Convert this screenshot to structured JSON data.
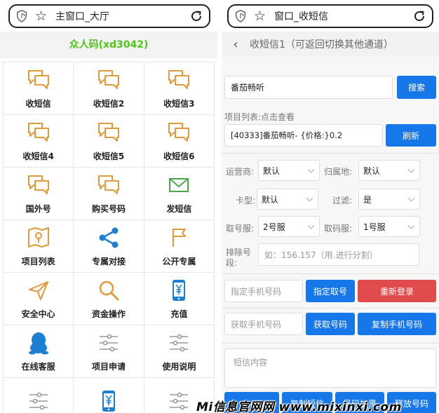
{
  "left": {
    "address_title": "主窗口_大厅",
    "brand": "众人码(xd3042)",
    "grid": [
      {
        "label": "收短信",
        "icon": "chat-bubbles-icon"
      },
      {
        "label": "收短信2",
        "icon": "chat-bubbles-icon"
      },
      {
        "label": "收短信3",
        "icon": "chat-bubbles-icon"
      },
      {
        "label": "收短信4",
        "icon": "chat-bubbles-icon"
      },
      {
        "label": "收短信5",
        "icon": "chat-bubbles-icon"
      },
      {
        "label": "收短信6",
        "icon": "chat-bubbles-icon"
      },
      {
        "label": "国外号",
        "icon": "chat-bubbles-icon"
      },
      {
        "label": "购买号码",
        "icon": "chat-bubbles-icon"
      },
      {
        "label": "发短信",
        "icon": "envelope-icon"
      },
      {
        "label": "项目列表",
        "icon": "map-icon"
      },
      {
        "label": "专属对接",
        "icon": "share-icon"
      },
      {
        "label": "公开专属",
        "icon": "flag-icon"
      },
      {
        "label": "安全中心",
        "icon": "paper-plane-icon"
      },
      {
        "label": "资金操作",
        "icon": "magnifier-icon"
      },
      {
        "label": "充值",
        "icon": "phone-yen-icon"
      },
      {
        "label": "在线客服",
        "icon": "qq-penguin-icon"
      },
      {
        "label": "项目申请",
        "icon": "sliders-icon"
      },
      {
        "label": "使用说明",
        "icon": "sliders-icon"
      },
      {
        "label": "",
        "icon": "sliders-icon"
      },
      {
        "label": "",
        "icon": "phone-yen-icon"
      },
      {
        "label": "",
        "icon": "sliders-icon"
      }
    ],
    "accent": "#e09a3a"
  },
  "right": {
    "address_title": "窗口_收短信",
    "header_title": "收短信1（可返回切换其他通道）",
    "search_value": "番茄畅听",
    "search_button": "搜索",
    "project_list_label": "项目列表:点击查看",
    "project_value": "[40333]番茄畅听- {价格:}0.2",
    "refresh_button": "刷新",
    "carrier_label": "运营商:",
    "carrier_value": "默认",
    "region_label": "归属地:",
    "region_value": "默认",
    "cardtype_label": "卡型:",
    "cardtype_value": "默认",
    "filter_label": "过滤:",
    "filter_value": "是",
    "fetch_server_label": "取号服:",
    "fetch_server_value": "2号服",
    "code_server_label": "取码服:",
    "code_server_value": "1号服",
    "exclude_label": "排除号段:",
    "exclude_placeholder": "如：156.157（用.进行分割）",
    "specify_phone_placeholder": "指定手机号码",
    "specify_fetch_button": "指定取号",
    "relogin_button": "重新登录",
    "get_phone_placeholder": "获取手机号码",
    "get_number_button": "获取号码",
    "copy_phone_button": "复制手机号码",
    "sms_placeholder": "短信内容",
    "bottom_buttons": [
      "",
      "复制短信",
      "号码加黑",
      "释放号码"
    ],
    "primary": "#1677e8",
    "danger": "#e24b4b"
  },
  "watermark": "Mi信息官网网 www.mixinxi.com"
}
